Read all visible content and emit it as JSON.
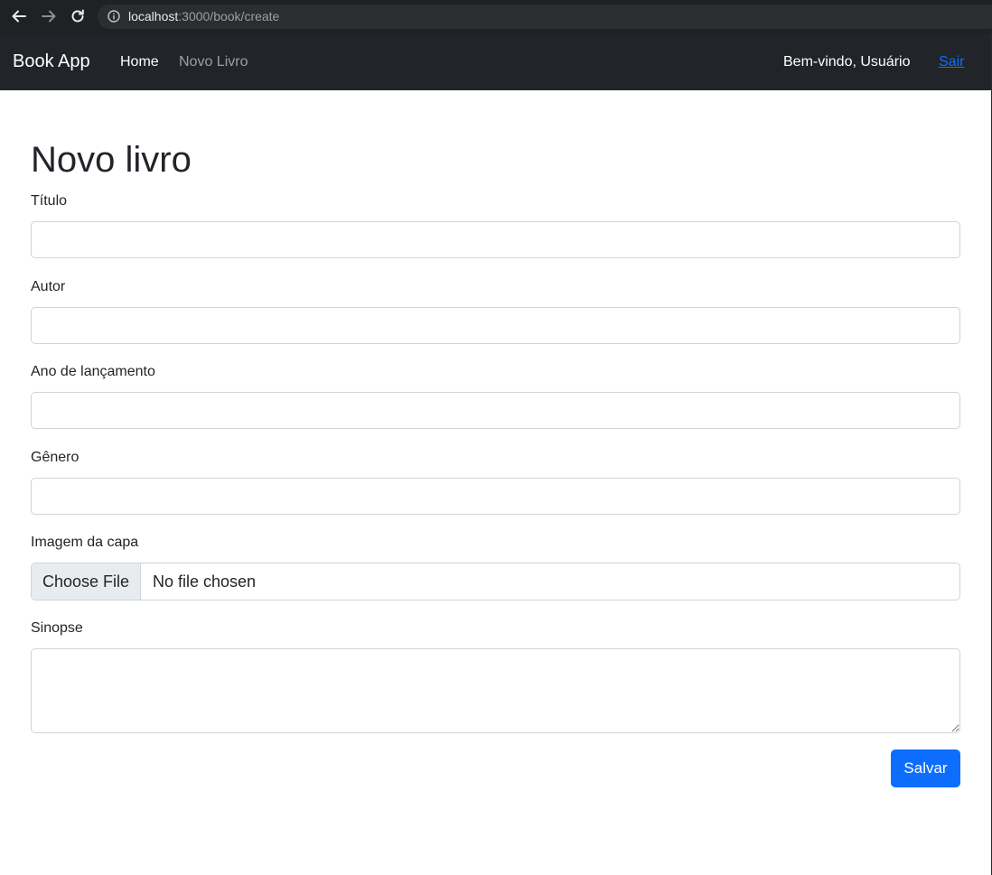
{
  "browser": {
    "url_host": "localhost",
    "url_path": ":3000/book/create"
  },
  "navbar": {
    "brand": "Book App",
    "links": [
      {
        "label": "Home"
      },
      {
        "label": "Novo Livro"
      }
    ],
    "welcome": "Bem-vindo, Usuário",
    "logout": "Sair",
    "colors": {
      "background": "#212529",
      "link_active": "#ffffff",
      "link_muted": "rgba(255,255,255,0.55)",
      "logout": "#0d6efd"
    }
  },
  "form": {
    "title": "Novo livro",
    "fields": {
      "titulo": {
        "label": "Título",
        "value": ""
      },
      "autor": {
        "label": "Autor",
        "value": ""
      },
      "ano": {
        "label": "Ano de lançamento",
        "value": ""
      },
      "genero": {
        "label": "Gênero",
        "value": ""
      },
      "capa": {
        "label": "Imagem da capa",
        "button": "Choose File",
        "status": "No file chosen"
      },
      "sinopse": {
        "label": "Sinopse",
        "value": ""
      }
    },
    "submit": "Salvar",
    "accent": "#0d6efd"
  },
  "icons": [
    "back-arrow-icon",
    "forward-arrow-icon",
    "reload-icon",
    "info-icon"
  ]
}
